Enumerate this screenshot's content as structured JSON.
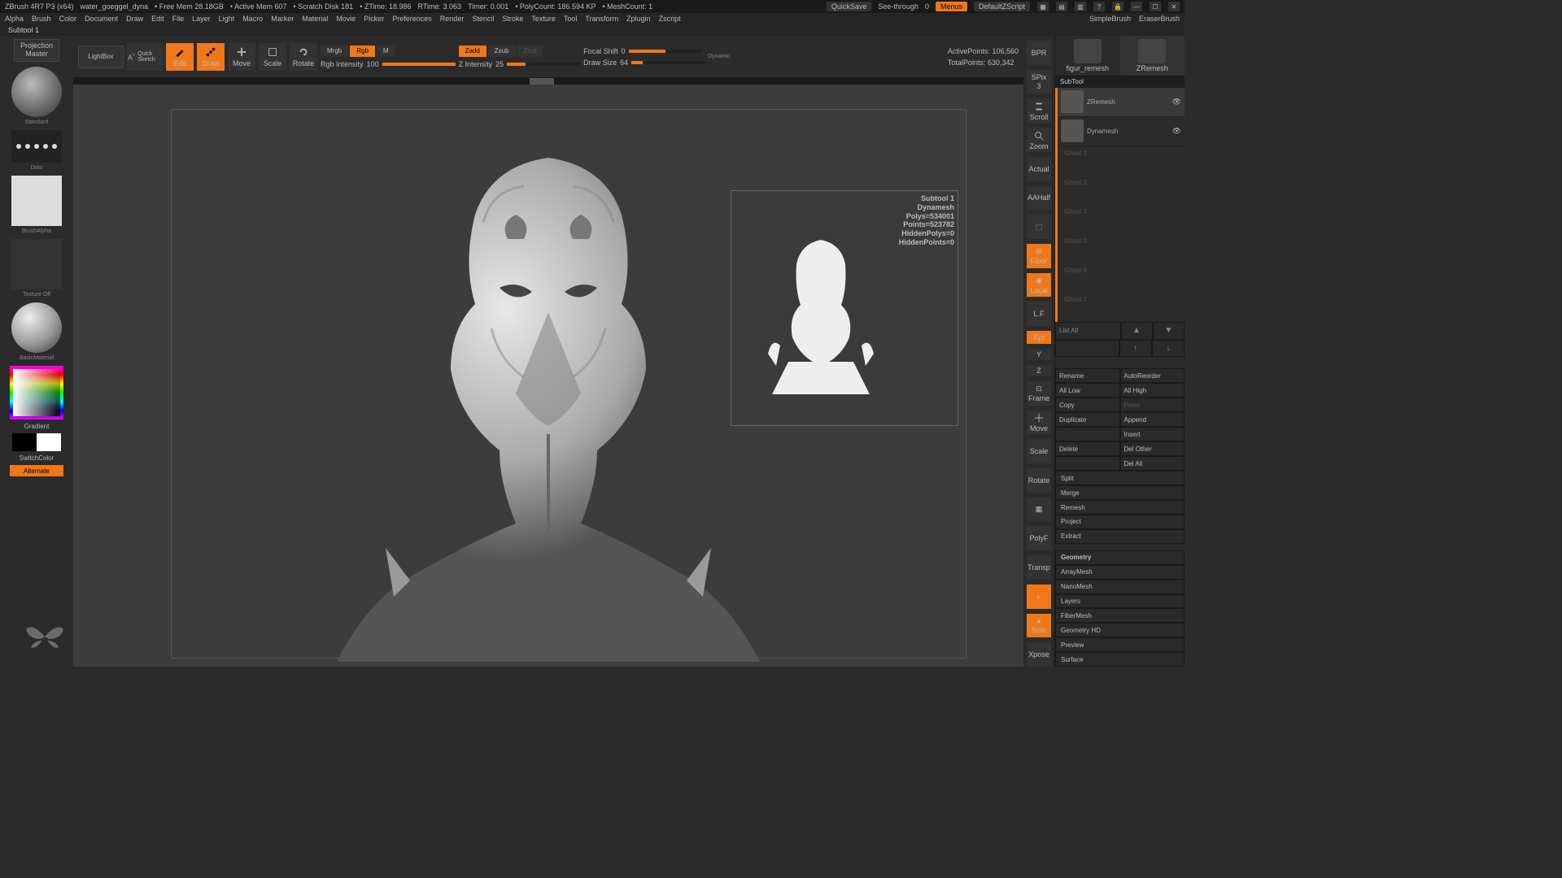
{
  "title": {
    "app": "ZBrush 4R7 P3 (x64)",
    "file": "water_goeggel_dyna",
    "freemem": "• Free Mem 28.18GB",
    "activemem": "• Active Mem 607",
    "scratch": "• Scratch Disk 181",
    "ztime": "• ZTime: 18.986",
    "rtime": "RTime: 3.063",
    "timer": "Timer: 0.001",
    "polycount": "• PolyCount: 186.594 KP",
    "meshcount": "• MeshCount: 1",
    "quicksave": "QuickSave",
    "seethrough": "See-through",
    "seethrough_val": "0",
    "menus": "Menus",
    "script": "DefaultZScript"
  },
  "menu": [
    "Alpha",
    "Brush",
    "Color",
    "Document",
    "Draw",
    "Edit",
    "File",
    "Layer",
    "Light",
    "Macro",
    "Marker",
    "Material",
    "Movie",
    "Picker",
    "Preferences",
    "Render",
    "Stencil",
    "Stroke",
    "Texture",
    "Tool",
    "Transform",
    "Zplugin",
    "Zscript"
  ],
  "menu_right": {
    "simple": "SimpleBrush",
    "eraser": "EraserBrush"
  },
  "docname": "Subtool 1",
  "left": {
    "pm1": "Projection",
    "pm2": "Master",
    "lightbox": "LightBox",
    "brush_lbl": "Standard",
    "stroke_lbl": "Dots",
    "alpha_lbl": "BrushAlpha",
    "tex_lbl": "Texture Off",
    "mat_lbl": "BasicMaterial",
    "grad": "Gradient",
    "switch": "SwitchColor",
    "alt": "Alternate"
  },
  "toolbar": {
    "qsk": "Quick Sketch",
    "edit": "Edit",
    "draw": "Draw",
    "move": "Move",
    "scale": "Scale",
    "rotate": "Rotate",
    "mrgb": "Mrgb",
    "rgb": "Rgb",
    "m": "M",
    "rgbint_lbl": "Rgb Intensity",
    "rgbint_val": "100",
    "zadd": "Zadd",
    "zsub": "Zsub",
    "zcut": "Zcut",
    "zint_lbl": "Z Intensity",
    "zint_val": "25",
    "focal_lbl": "Focal Shift",
    "focal_val": "0",
    "draw_lbl": "Draw Size",
    "draw_val": "64",
    "dynamic": "Dynamic",
    "active_lbl": "ActivePoints:",
    "active_val": "106,560",
    "total_lbl": "TotalPoints:",
    "total_val": "630,342"
  },
  "tooltip": {
    "l1": "Subtool 1",
    "l2": "Dynamesh",
    "l3": "Polys=534001",
    "l4": "Points=523782",
    "l5": "HiddenPolys=0",
    "l6": "HiddenPoints=0"
  },
  "rside": {
    "bpr": "BPR",
    "spix_lbl": "SPix",
    "spix_val": "3",
    "scroll": "Scroll",
    "zoom": "Zoom",
    "actual": "Actual",
    "aahalf": "AAHalf",
    "persp": "Persp",
    "floor": "Floor",
    "local": "Local",
    "lf": "L.F",
    "xyz": "Xyz",
    "y": "Y",
    "z": "Z",
    "frame": "Frame",
    "move": "Move",
    "scale": "Scale",
    "rotate": "Rotate",
    "linefill": "Line Fill",
    "polyf": "PolyF",
    "transp": "Transp",
    "ghost": "Ghost",
    "solo": "Solo",
    "xpose": "Xpose"
  },
  "right": {
    "tools": [
      "figur_remesh",
      "ZRemesh"
    ],
    "subtool_hdr": "SubTool",
    "subtools": [
      {
        "name": "ZRemesh",
        "active": true
      },
      {
        "name": "Dynamesh",
        "active": false
      }
    ],
    "empties": [
      "Ghost 2",
      "Ghost 3",
      "Ghost 4",
      "Ghost 5",
      "Ghost 6",
      "Ghost 7"
    ],
    "listall": "List All",
    "rename": "Rename",
    "autoreorder": "AutoReorder",
    "alllow": "All Low",
    "allhigh": "All High",
    "copy": "Copy",
    "paste": "Paste",
    "duplicate": "Duplicate",
    "append": "Append",
    "insert": "Insert",
    "delete": "Delete",
    "delother": "Del Other",
    "delall": "Del All",
    "split": "Split",
    "merge": "Merge",
    "remesh": "Remesh",
    "project": "Project",
    "extract": "Extract",
    "geometry": "Geometry",
    "arraymesh": "ArrayMesh",
    "nanomesh": "NanoMesh",
    "layers": "Layers",
    "fibermesh": "FiberMesh",
    "geometryhd": "Geometry HD",
    "preview": "Preview",
    "surface": "Surface"
  }
}
